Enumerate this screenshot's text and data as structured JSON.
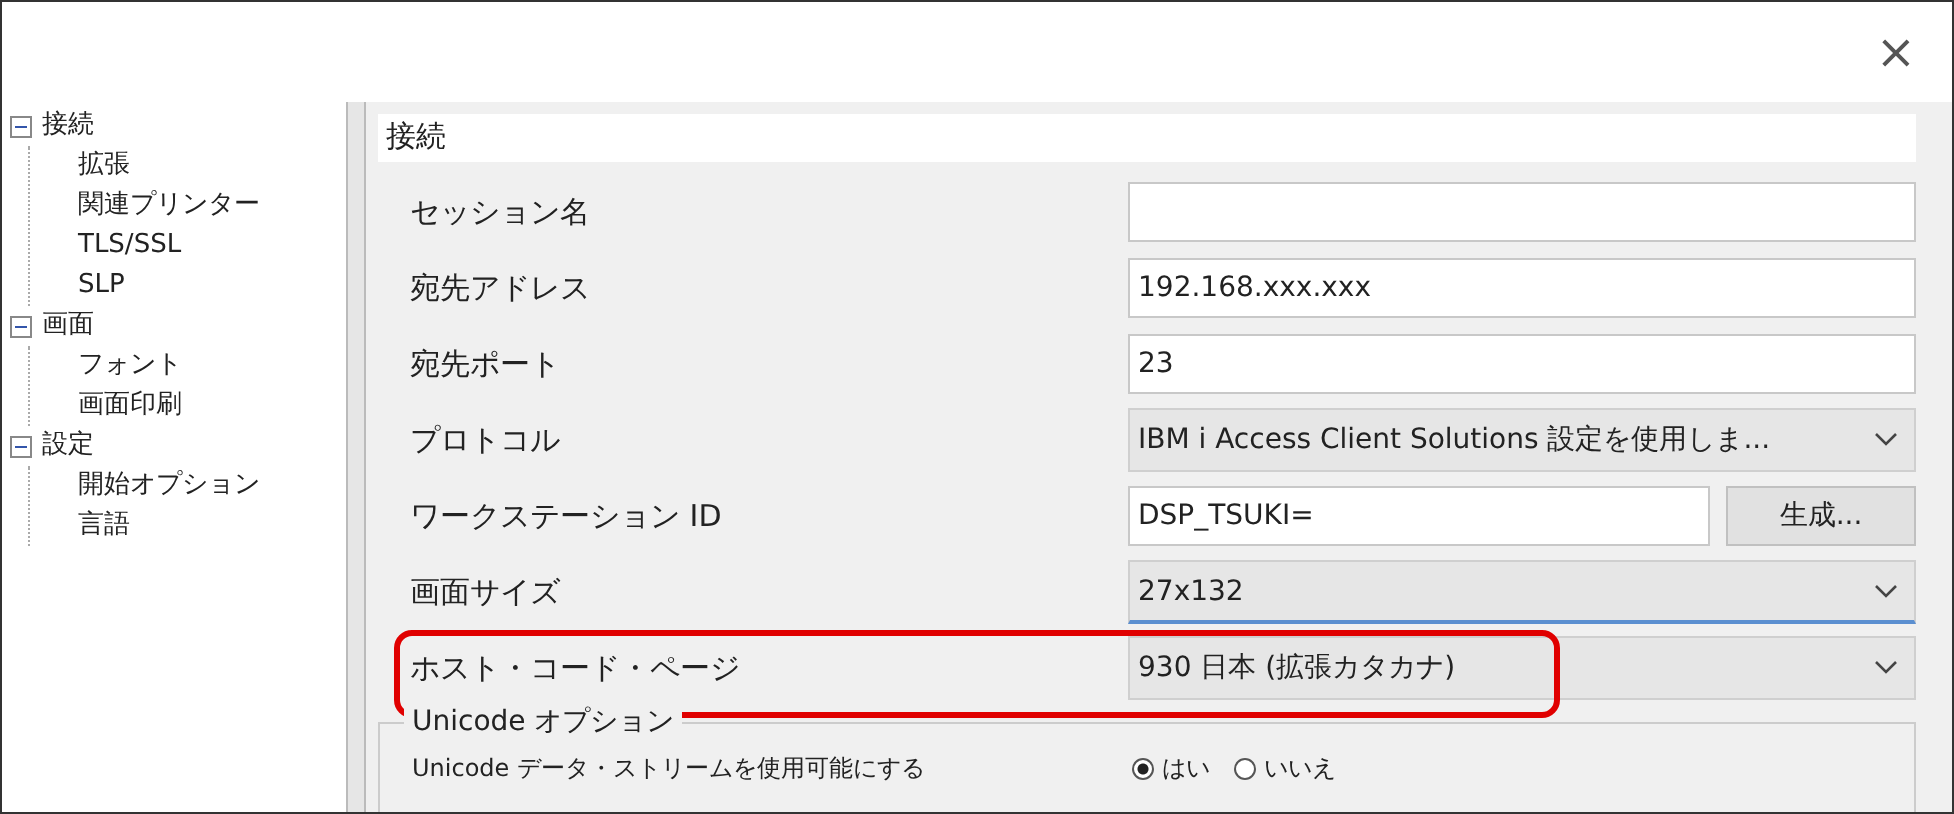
{
  "window": {
    "close": "×"
  },
  "tree": [
    {
      "label": "接続",
      "expanded": true,
      "children": [
        {
          "label": "拡張"
        },
        {
          "label": "関連プリンター"
        },
        {
          "label": "TLS/SSL"
        },
        {
          "label": "SLP"
        }
      ]
    },
    {
      "label": "画面",
      "expanded": true,
      "children": [
        {
          "label": "フォント"
        },
        {
          "label": "画面印刷"
        }
      ]
    },
    {
      "label": "設定",
      "expanded": true,
      "children": [
        {
          "label": "開始オプション"
        },
        {
          "label": "言語"
        }
      ]
    }
  ],
  "panel": {
    "title": "接続",
    "rows": [
      {
        "kind": "text",
        "label": "セッション名",
        "value": ""
      },
      {
        "kind": "text",
        "label": "宛先アドレス",
        "value": "192.168.xxx.xxx"
      },
      {
        "kind": "text",
        "label": "宛先ポート",
        "value": "23"
      },
      {
        "kind": "select",
        "label": "プロトコル",
        "value": "IBM i Access Client Solutions 設定を使用しま..."
      },
      {
        "kind": "text_button",
        "label": "ワークステーション ID",
        "value": "DSP_TSUKI=",
        "button": "生成..."
      },
      {
        "kind": "select",
        "label": "画面サイズ",
        "value": "27x132",
        "focused": true
      },
      {
        "kind": "select",
        "label": "ホスト・コード・ページ",
        "value": "930 日本 (拡張カタカナ)",
        "highlighted": true
      }
    ],
    "group": {
      "title": "Unicode オプション",
      "row": {
        "label": "Unicode データ・ストリームを使用可能にする",
        "options": [
          {
            "label": "はい",
            "selected": true
          },
          {
            "label": "いいえ",
            "selected": false
          }
        ]
      }
    }
  }
}
